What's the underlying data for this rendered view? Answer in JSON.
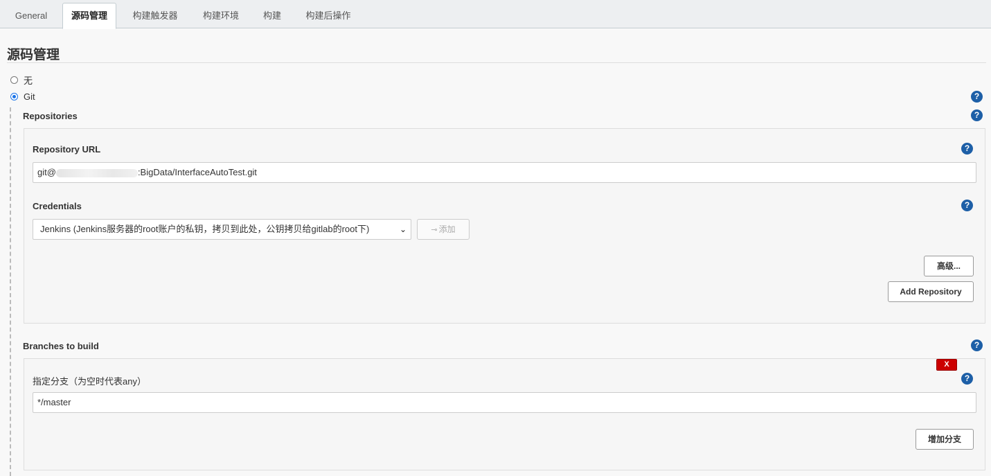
{
  "tabs": [
    {
      "label": "General",
      "active": false
    },
    {
      "label": "源码管理",
      "active": true
    },
    {
      "label": "构建触发器",
      "active": false
    },
    {
      "label": "构建环境",
      "active": false
    },
    {
      "label": "构建",
      "active": false
    },
    {
      "label": "构建后操作",
      "active": false
    }
  ],
  "section": {
    "title": "源码管理"
  },
  "scm_options": {
    "none_label": "无",
    "git_label": "Git",
    "selected": "Git"
  },
  "repositories": {
    "title": "Repositories",
    "url_label": "Repository URL",
    "url_value_prefix": "git@",
    "url_value_suffix": ":BigData/InterfaceAutoTest.git",
    "credentials_label": "Credentials",
    "credentials_value": "Jenkins (Jenkins服务器的root账户的私钥，拷贝到此处，公钥拷贝给gitlab的root下)",
    "add_button": "添加",
    "advanced_button": "高级...",
    "add_repository_button": "Add Repository"
  },
  "branches": {
    "title": "Branches to build",
    "delete_button": "X",
    "specifier_label": "指定分支（为空时代表any）",
    "specifier_value": "*/master",
    "add_branch_button": "增加分支"
  },
  "icons": {
    "help": "help-icon",
    "key": "key-icon",
    "chevron": "chevron-down-icon"
  },
  "colors": {
    "help_icon": "#1d5fa7",
    "radio_checked": "#1a73e8",
    "delete_button": "#cc0000"
  }
}
